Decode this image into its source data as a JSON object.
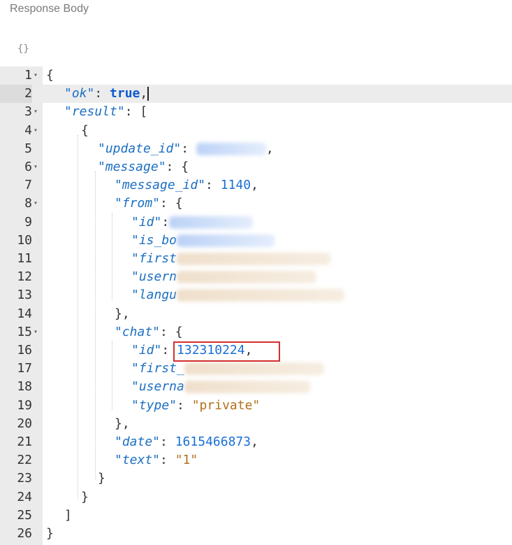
{
  "header": {
    "title": "Response Body",
    "format_icon": "{}"
  },
  "fold_marker": "▾",
  "lines": [
    {
      "n": "1",
      "fold": true,
      "parts": [
        {
          "t": "{",
          "c": "punc"
        }
      ]
    },
    {
      "n": "2",
      "active": true,
      "parts": [
        {
          "t": "\"ok\"",
          "c": "key"
        },
        {
          "t": ": ",
          "c": "punc"
        },
        {
          "t": "true",
          "c": "bool"
        },
        {
          "t": ",",
          "c": "punc"
        },
        {
          "cursor": true
        }
      ]
    },
    {
      "n": "3",
      "fold": true,
      "parts": [
        {
          "t": "\"result\"",
          "c": "key"
        },
        {
          "t": ": [",
          "c": "punc"
        }
      ]
    },
    {
      "n": "4",
      "fold": true,
      "parts": [
        {
          "t": "{",
          "c": "punc"
        }
      ]
    },
    {
      "n": "5",
      "parts": [
        {
          "t": "\"update_id\"",
          "c": "key"
        },
        {
          "t": ": ",
          "c": "punc"
        },
        {
          "blur": 100
        },
        {
          "t": ",",
          "c": "punc"
        }
      ]
    },
    {
      "n": "6",
      "fold": true,
      "parts": [
        {
          "t": "\"message\"",
          "c": "key"
        },
        {
          "t": ": {",
          "c": "punc"
        }
      ]
    },
    {
      "n": "7",
      "parts": [
        {
          "t": "\"message_id\"",
          "c": "key"
        },
        {
          "t": ": ",
          "c": "punc"
        },
        {
          "t": "1140",
          "c": "num"
        },
        {
          "t": ",",
          "c": "punc"
        }
      ]
    },
    {
      "n": "8",
      "fold": true,
      "parts": [
        {
          "t": "\"from\"",
          "c": "key"
        },
        {
          "t": ": {",
          "c": "punc"
        }
      ]
    },
    {
      "n": "9",
      "parts": [
        {
          "t": "\"id\"",
          "c": "key"
        },
        {
          "t": ":",
          "c": "punc"
        },
        {
          "blur": 120
        }
      ]
    },
    {
      "n": "10",
      "parts": [
        {
          "t": "\"is_bo",
          "c": "key"
        },
        {
          "blur": 140
        }
      ]
    },
    {
      "n": "11",
      "parts": [
        {
          "t": "\"first",
          "c": "key"
        },
        {
          "blur": 220,
          "tan": true
        }
      ]
    },
    {
      "n": "12",
      "parts": [
        {
          "t": "\"usern",
          "c": "key"
        },
        {
          "blur": 200,
          "tan": true
        }
      ]
    },
    {
      "n": "13",
      "parts": [
        {
          "t": "\"langu",
          "c": "key"
        },
        {
          "blur": 240,
          "tan": true
        }
      ]
    },
    {
      "n": "14",
      "parts": [
        {
          "t": "},",
          "c": "punc"
        }
      ]
    },
    {
      "n": "15",
      "fold": true,
      "parts": [
        {
          "t": "\"chat\"",
          "c": "key"
        },
        {
          "t": ": {",
          "c": "punc"
        }
      ]
    },
    {
      "n": "16",
      "parts": [
        {
          "t": "\"id\"",
          "c": "key"
        },
        {
          "t": ": ",
          "c": "punc"
        },
        {
          "t": "132310224",
          "c": "num"
        },
        {
          "t": ",",
          "c": "punc"
        }
      ]
    },
    {
      "n": "17",
      "parts": [
        {
          "t": "\"first_",
          "c": "key"
        },
        {
          "blur": 200,
          "tan": true
        }
      ]
    },
    {
      "n": "18",
      "parts": [
        {
          "t": "\"userna",
          "c": "key"
        },
        {
          "blur": 180,
          "tan": true
        }
      ]
    },
    {
      "n": "19",
      "parts": [
        {
          "t": "\"type\"",
          "c": "key"
        },
        {
          "t": ": ",
          "c": "punc"
        },
        {
          "t": "\"private\"",
          "c": "str"
        }
      ]
    },
    {
      "n": "20",
      "parts": [
        {
          "t": "},",
          "c": "punc"
        }
      ]
    },
    {
      "n": "21",
      "parts": [
        {
          "t": "\"date\"",
          "c": "key"
        },
        {
          "t": ": ",
          "c": "punc"
        },
        {
          "t": "1615466873",
          "c": "num"
        },
        {
          "t": ",",
          "c": "punc"
        }
      ]
    },
    {
      "n": "22",
      "parts": [
        {
          "t": "\"text\"",
          "c": "key"
        },
        {
          "t": ": ",
          "c": "punc"
        },
        {
          "t": "\"1\"",
          "c": "str"
        }
      ]
    },
    {
      "n": "23",
      "parts": [
        {
          "t": "}",
          "c": "punc"
        }
      ]
    },
    {
      "n": "24",
      "parts": [
        {
          "t": "}",
          "c": "punc"
        }
      ]
    },
    {
      "n": "25",
      "parts": [
        {
          "t": "]",
          "c": "punc"
        }
      ]
    },
    {
      "n": "26",
      "parts": [
        {
          "t": "}",
          "c": "punc"
        }
      ]
    }
  ]
}
